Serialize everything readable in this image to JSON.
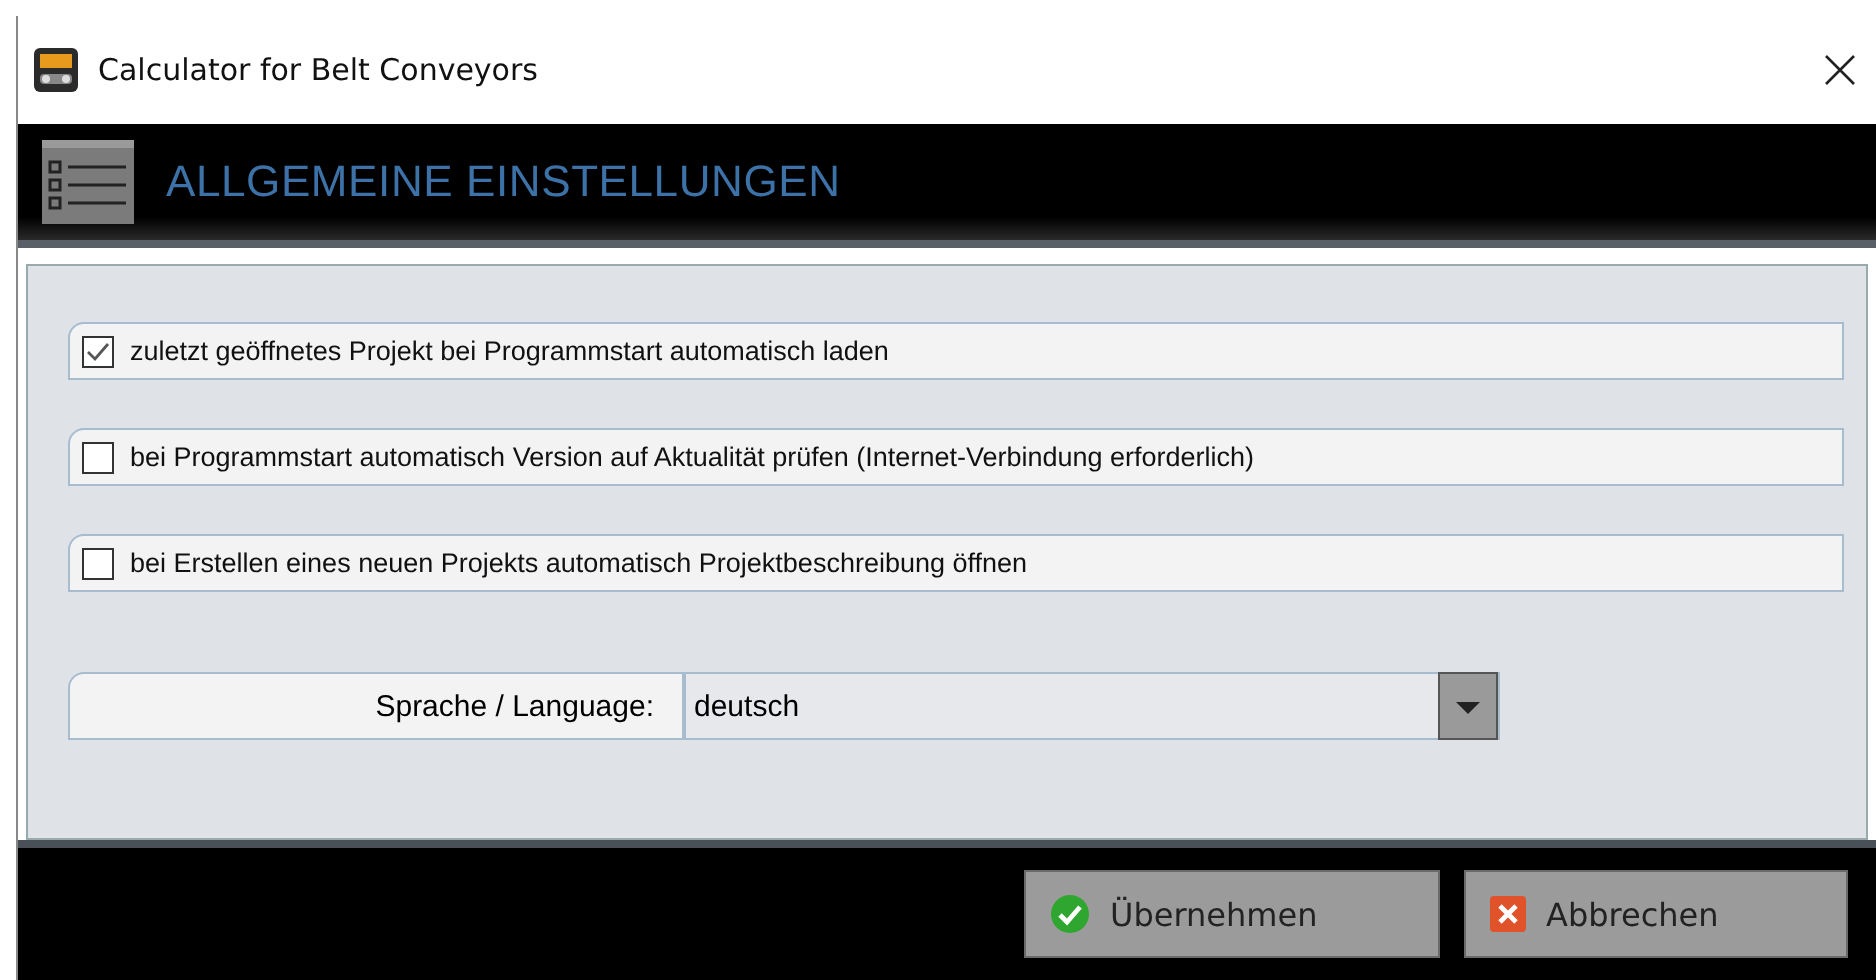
{
  "window": {
    "title": "Calculator for Belt Conveyors"
  },
  "header": {
    "title": "ALLGEMEINE EINSTELLUNGEN"
  },
  "options": [
    {
      "label": "zuletzt geöffnetes Projekt bei Programmstart automatisch laden",
      "checked": true
    },
    {
      "label": "bei Programmstart automatisch Version auf Aktualität prüfen (Internet-Verbindung erforderlich)",
      "checked": false
    },
    {
      "label": "bei Erstellen eines neuen Projekts automatisch Projektbeschreibung öffnen",
      "checked": false
    }
  ],
  "language": {
    "label": "Sprache / Language:",
    "value": "deutsch"
  },
  "buttons": [
    {
      "label": "Übernehmen",
      "kind": "ok"
    },
    {
      "label": "Abbrechen",
      "kind": "cancel"
    }
  ]
}
